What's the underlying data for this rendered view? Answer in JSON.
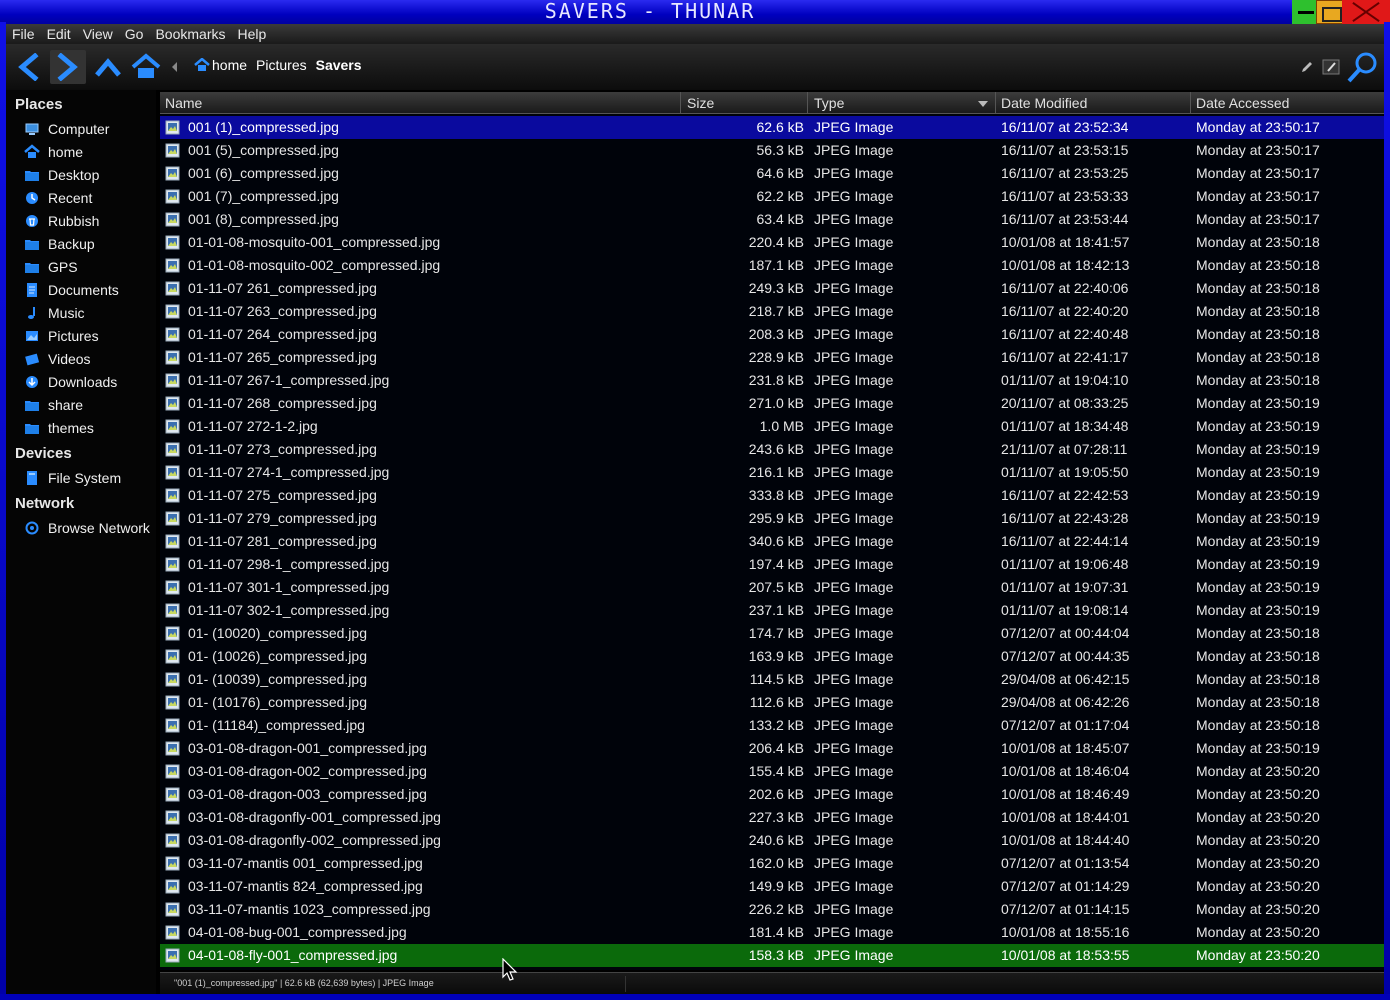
{
  "window": {
    "title": "SAVERS - THUNAR"
  },
  "menubar": [
    "File",
    "Edit",
    "View",
    "Go",
    "Bookmarks",
    "Help"
  ],
  "toolbar": {
    "breadcrumb": [
      "home",
      "Pictures",
      "Savers"
    ]
  },
  "sidebar": {
    "places_title": "Places",
    "places": [
      {
        "label": "Computer",
        "icon": "computer-icon"
      },
      {
        "label": "home",
        "icon": "home-icon"
      },
      {
        "label": "Desktop",
        "icon": "folder-icon"
      },
      {
        "label": "Recent",
        "icon": "recent-icon"
      },
      {
        "label": "Rubbish",
        "icon": "trash-icon"
      },
      {
        "label": "Backup",
        "icon": "folder-icon"
      },
      {
        "label": "GPS",
        "icon": "folder-icon"
      },
      {
        "label": "Documents",
        "icon": "documents-icon"
      },
      {
        "label": "Music",
        "icon": "music-icon"
      },
      {
        "label": "Pictures",
        "icon": "pictures-icon"
      },
      {
        "label": "Videos",
        "icon": "videos-icon"
      },
      {
        "label": "Downloads",
        "icon": "downloads-icon"
      },
      {
        "label": "share",
        "icon": "folder-icon"
      },
      {
        "label": "themes",
        "icon": "folder-icon"
      }
    ],
    "devices_title": "Devices",
    "devices": [
      {
        "label": "File System",
        "icon": "drive-icon"
      }
    ],
    "network_title": "Network",
    "network": [
      {
        "label": "Browse Network",
        "icon": "network-icon"
      }
    ]
  },
  "columns": [
    "Name",
    "Size",
    "Type",
    "Date Modified",
    "Date Accessed"
  ],
  "files": [
    [
      "001 (1)_compressed.jpg",
      "62.6 kB",
      "JPEG Image",
      "16/11/07 at 23:52:34",
      "Monday at 23:50:17"
    ],
    [
      "001 (5)_compressed.jpg",
      "56.3 kB",
      "JPEG Image",
      "16/11/07 at 23:53:15",
      "Monday at 23:50:17"
    ],
    [
      "001 (6)_compressed.jpg",
      "64.6 kB",
      "JPEG Image",
      "16/11/07 at 23:53:25",
      "Monday at 23:50:17"
    ],
    [
      "001 (7)_compressed.jpg",
      "62.2 kB",
      "JPEG Image",
      "16/11/07 at 23:53:33",
      "Monday at 23:50:17"
    ],
    [
      "001 (8)_compressed.jpg",
      "63.4 kB",
      "JPEG Image",
      "16/11/07 at 23:53:44",
      "Monday at 23:50:17"
    ],
    [
      "01-01-08-mosquito-001_compressed.jpg",
      "220.4 kB",
      "JPEG Image",
      "10/01/08 at 18:41:57",
      "Monday at 23:50:18"
    ],
    [
      "01-01-08-mosquito-002_compressed.jpg",
      "187.1 kB",
      "JPEG Image",
      "10/01/08 at 18:42:13",
      "Monday at 23:50:18"
    ],
    [
      "01-11-07 261_compressed.jpg",
      "249.3 kB",
      "JPEG Image",
      "16/11/07 at 22:40:06",
      "Monday at 23:50:18"
    ],
    [
      "01-11-07 263_compressed.jpg",
      "218.7 kB",
      "JPEG Image",
      "16/11/07 at 22:40:20",
      "Monday at 23:50:18"
    ],
    [
      "01-11-07 264_compressed.jpg",
      "208.3 kB",
      "JPEG Image",
      "16/11/07 at 22:40:48",
      "Monday at 23:50:18"
    ],
    [
      "01-11-07 265_compressed.jpg",
      "228.9 kB",
      "JPEG Image",
      "16/11/07 at 22:41:17",
      "Monday at 23:50:18"
    ],
    [
      "01-11-07 267-1_compressed.jpg",
      "231.8 kB",
      "JPEG Image",
      "01/11/07 at 19:04:10",
      "Monday at 23:50:18"
    ],
    [
      "01-11-07 268_compressed.jpg",
      "271.0 kB",
      "JPEG Image",
      "20/11/07 at 08:33:25",
      "Monday at 23:50:19"
    ],
    [
      "01-11-07 272-1-2.jpg",
      "1.0 MB",
      "JPEG Image",
      "01/11/07 at 18:34:48",
      "Monday at 23:50:19"
    ],
    [
      "01-11-07 273_compressed.jpg",
      "243.6 kB",
      "JPEG Image",
      "21/11/07 at 07:28:11",
      "Monday at 23:50:19"
    ],
    [
      "01-11-07 274-1_compressed.jpg",
      "216.1 kB",
      "JPEG Image",
      "01/11/07 at 19:05:50",
      "Monday at 23:50:19"
    ],
    [
      "01-11-07 275_compressed.jpg",
      "333.8 kB",
      "JPEG Image",
      "16/11/07 at 22:42:53",
      "Monday at 23:50:19"
    ],
    [
      "01-11-07 279_compressed.jpg",
      "295.9 kB",
      "JPEG Image",
      "16/11/07 at 22:43:28",
      "Monday at 23:50:19"
    ],
    [
      "01-11-07 281_compressed.jpg",
      "340.6 kB",
      "JPEG Image",
      "16/11/07 at 22:44:14",
      "Monday at 23:50:19"
    ],
    [
      "01-11-07 298-1_compressed.jpg",
      "197.4 kB",
      "JPEG Image",
      "01/11/07 at 19:06:48",
      "Monday at 23:50:19"
    ],
    [
      "01-11-07 301-1_compressed.jpg",
      "207.5 kB",
      "JPEG Image",
      "01/11/07 at 19:07:31",
      "Monday at 23:50:19"
    ],
    [
      "01-11-07 302-1_compressed.jpg",
      "237.1 kB",
      "JPEG Image",
      "01/11/07 at 19:08:14",
      "Monday at 23:50:19"
    ],
    [
      "01- (10020)_compressed.jpg",
      "174.7 kB",
      "JPEG Image",
      "07/12/07 at 00:44:04",
      "Monday at 23:50:18"
    ],
    [
      "01- (10026)_compressed.jpg",
      "163.9 kB",
      "JPEG Image",
      "07/12/07 at 00:44:35",
      "Monday at 23:50:18"
    ],
    [
      "01- (10039)_compressed.jpg",
      "114.5 kB",
      "JPEG Image",
      "29/04/08 at 06:42:15",
      "Monday at 23:50:18"
    ],
    [
      "01- (10176)_compressed.jpg",
      "112.6 kB",
      "JPEG Image",
      "29/04/08 at 06:42:26",
      "Monday at 23:50:18"
    ],
    [
      "01- (11184)_compressed.jpg",
      "133.2 kB",
      "JPEG Image",
      "07/12/07 at 01:17:04",
      "Monday at 23:50:18"
    ],
    [
      "03-01-08-dragon-001_compressed.jpg",
      "206.4 kB",
      "JPEG Image",
      "10/01/08 at 18:45:07",
      "Monday at 23:50:19"
    ],
    [
      "03-01-08-dragon-002_compressed.jpg",
      "155.4 kB",
      "JPEG Image",
      "10/01/08 at 18:46:04",
      "Monday at 23:50:20"
    ],
    [
      "03-01-08-dragon-003_compressed.jpg",
      "202.6 kB",
      "JPEG Image",
      "10/01/08 at 18:46:49",
      "Monday at 23:50:20"
    ],
    [
      "03-01-08-dragonfly-001_compressed.jpg",
      "227.3 kB",
      "JPEG Image",
      "10/01/08 at 18:44:01",
      "Monday at 23:50:20"
    ],
    [
      "03-01-08-dragonfly-002_compressed.jpg",
      "240.6 kB",
      "JPEG Image",
      "10/01/08 at 18:44:40",
      "Monday at 23:50:20"
    ],
    [
      "03-11-07-mantis 001_compressed.jpg",
      "162.0 kB",
      "JPEG Image",
      "07/12/07 at 01:13:54",
      "Monday at 23:50:20"
    ],
    [
      "03-11-07-mantis 824_compressed.jpg",
      "149.9 kB",
      "JPEG Image",
      "07/12/07 at 01:14:29",
      "Monday at 23:50:20"
    ],
    [
      "03-11-07-mantis 1023_compressed.jpg",
      "226.2 kB",
      "JPEG Image",
      "07/12/07 at 01:14:15",
      "Monday at 23:50:20"
    ],
    [
      "04-01-08-bug-001_compressed.jpg",
      "181.4 kB",
      "JPEG Image",
      "10/01/08 at 18:55:16",
      "Monday at 23:50:20"
    ],
    [
      "04-01-08-fly-001_compressed.jpg",
      "158.3 kB",
      "JPEG Image",
      "10/01/08 at 18:53:55",
      "Monday at 23:50:20"
    ]
  ],
  "selected_row": 0,
  "hover_row": 36,
  "statusbar": {
    "text": "\"001 (1)_compressed.jpg\" | 62.6 kB (62,639 bytes) | JPEG Image"
  },
  "colors": {
    "accent": "#1e90ff",
    "selection": "#0a0a9e",
    "hover": "#0b6a0b",
    "titlebar": "#0000c0"
  }
}
